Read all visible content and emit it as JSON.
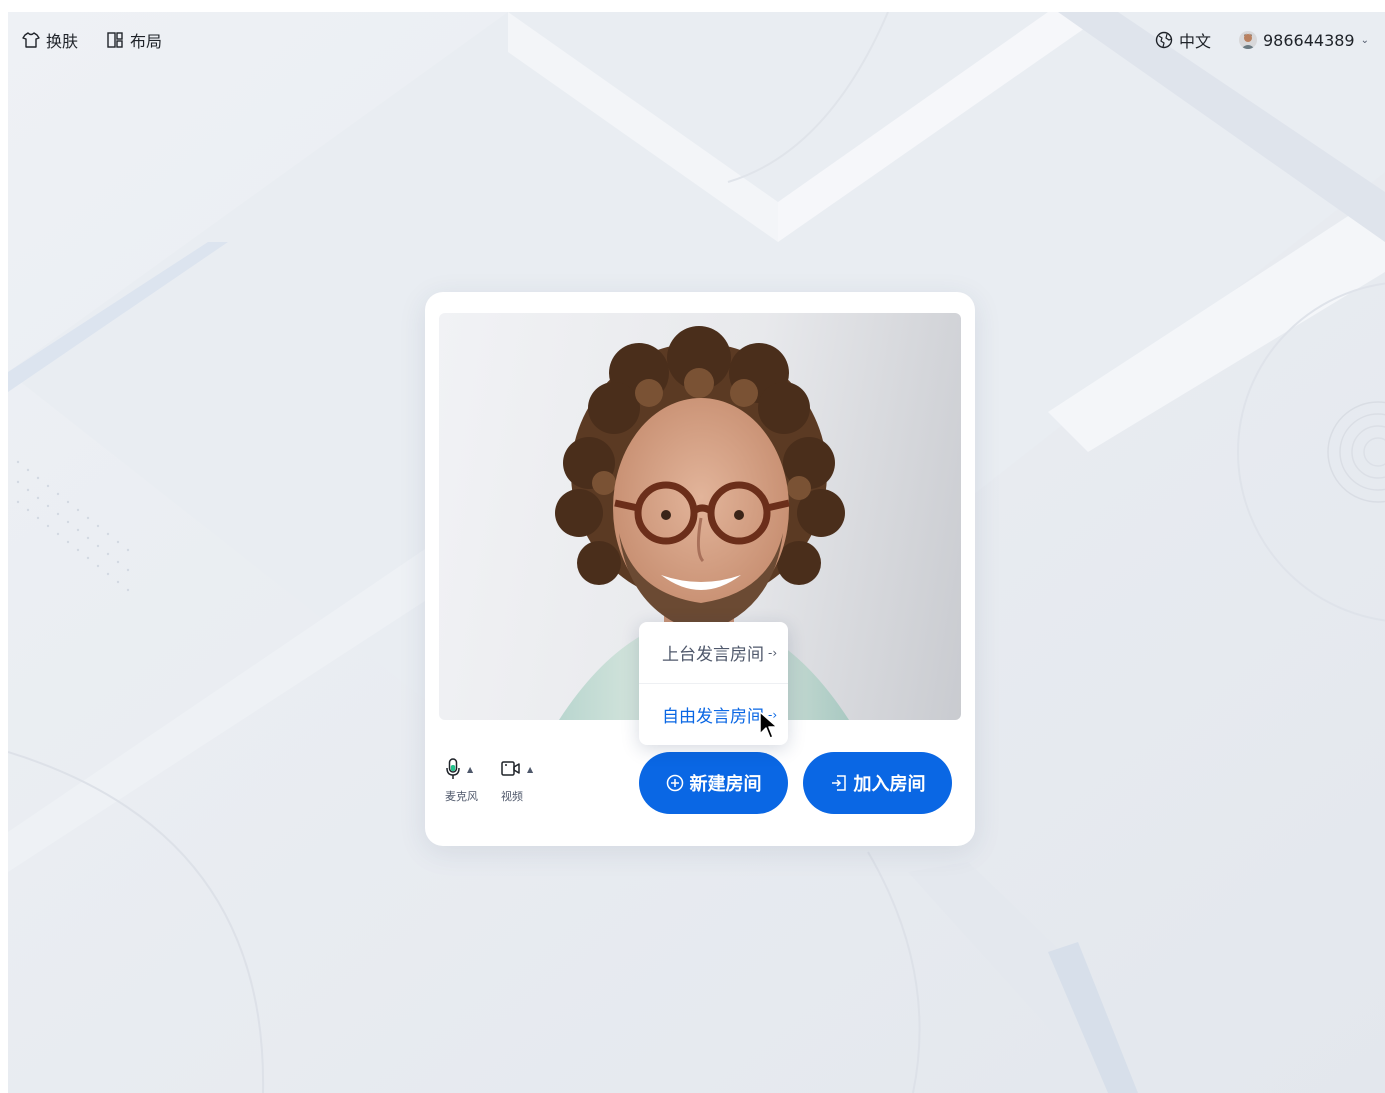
{
  "topbar": {
    "skin_label": "换肤",
    "layout_label": "布局",
    "language_label": "中文",
    "user_id": "986644389"
  },
  "preview": {
    "mic_label": "麦克风",
    "video_label": "视频"
  },
  "actions": {
    "create_room": "新建房间",
    "join_room": "加入房间"
  },
  "room_type_menu": {
    "items": [
      {
        "label": "上台发言房间",
        "active": false
      },
      {
        "label": "自由发言房间",
        "active": true
      }
    ]
  },
  "colors": {
    "primary": "#0a67e4",
    "background": "#e8ebf0",
    "text": "#1f2329",
    "mic_active": "#23c28b"
  },
  "icons": {
    "skin": "shirt-icon",
    "layout": "layout-grid-icon",
    "language": "globe-icon",
    "mic": "microphone-icon",
    "video": "camera-icon",
    "create": "plus-circle-icon",
    "join": "enter-icon",
    "menu_arrow": "arrow-right-icon",
    "user_menu": "chevron-down-icon"
  }
}
